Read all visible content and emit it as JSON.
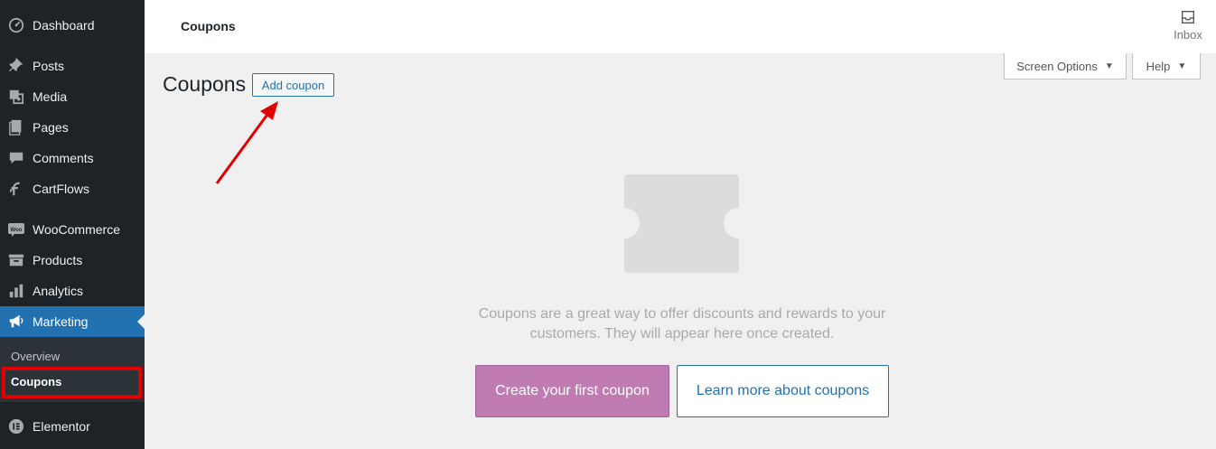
{
  "sidebar": {
    "items": [
      {
        "label": "Dashboard",
        "icon": "dashboard-icon"
      },
      {
        "label": "Posts",
        "icon": "pin-icon"
      },
      {
        "label": "Media",
        "icon": "media-icon"
      },
      {
        "label": "Pages",
        "icon": "pages-icon"
      },
      {
        "label": "Comments",
        "icon": "comment-icon"
      },
      {
        "label": "CartFlows",
        "icon": "cartflows-icon"
      },
      {
        "label": "WooCommerce",
        "icon": "woo-icon"
      },
      {
        "label": "Products",
        "icon": "archive-icon"
      },
      {
        "label": "Analytics",
        "icon": "chart-bar-icon"
      },
      {
        "label": "Marketing",
        "icon": "megaphone-icon"
      },
      {
        "label": "Elementor",
        "icon": "elementor-icon"
      }
    ],
    "submenu": [
      {
        "label": "Overview"
      },
      {
        "label": "Coupons"
      }
    ],
    "woo_badge": "Woo",
    "active_color": "#2271b1",
    "highlight_color": "#e00000"
  },
  "topbar": {
    "title": "Coupons",
    "inbox_label": "Inbox"
  },
  "tabs": {
    "screen_options": "Screen Options",
    "help": "Help",
    "caret": "▼"
  },
  "page": {
    "heading": "Coupons",
    "add_button": "Add coupon"
  },
  "empty_state": {
    "message": "Coupons are a great way to offer discounts and rewards to your customers. They will appear here once created.",
    "primary_button": "Create your first coupon",
    "secondary_button": "Learn more about coupons",
    "primary_color": "#c17bb3",
    "illustration_icon": "coupon-icon"
  },
  "annotation": {
    "arrow_color": "#e00000"
  }
}
